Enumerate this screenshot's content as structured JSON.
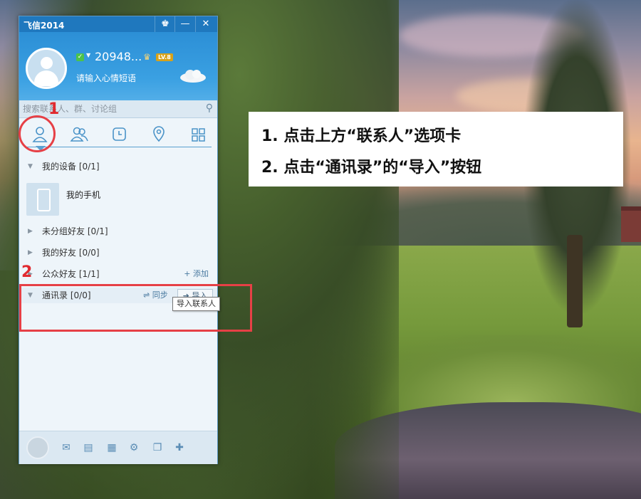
{
  "window": {
    "app_title": "飞信2014",
    "controls": {
      "skin": "♚",
      "minimize": "—",
      "close": "✕"
    }
  },
  "profile": {
    "number": "20948...",
    "level_badge": "LV.8",
    "mood_placeholder": "请输入心情短语"
  },
  "search": {
    "placeholder": "搜索联系人、群、讨论组"
  },
  "tabs": [
    {
      "name": "contacts",
      "icon": "person-icon"
    },
    {
      "name": "groups",
      "icon": "group-icon"
    },
    {
      "name": "recent",
      "icon": "clock-icon"
    },
    {
      "name": "nearby",
      "icon": "location-icon"
    },
    {
      "name": "apps",
      "icon": "grid-icon"
    }
  ],
  "groups": {
    "my_devices": "我的设备",
    "my_devices_count": "[0/1]",
    "my_phone": "我的手机",
    "ungrouped": "未分组好友",
    "ungrouped_count": "[0/1]",
    "my_friends": "我的好友",
    "my_friends_count": "[0/0]",
    "public_friends": "公众好友",
    "public_friends_count": "[1/1]",
    "add_link": "+ 添加",
    "address_book": "通讯录",
    "address_book_count": "[0/0]",
    "sync": "⇌ 同步",
    "import": "➜ 导入",
    "tooltip": "导入联系人"
  },
  "annotations": {
    "step1_num": "1",
    "step2_num": "2",
    "callout_line1": "1. 点击上方“联系人”选项卡",
    "callout_line2": "2. 点击“通讯录”的“导入”按钮"
  },
  "colors": {
    "titlebar": "#1f78be",
    "header": "#3aa0e2",
    "annotation_red": "#e64046"
  }
}
